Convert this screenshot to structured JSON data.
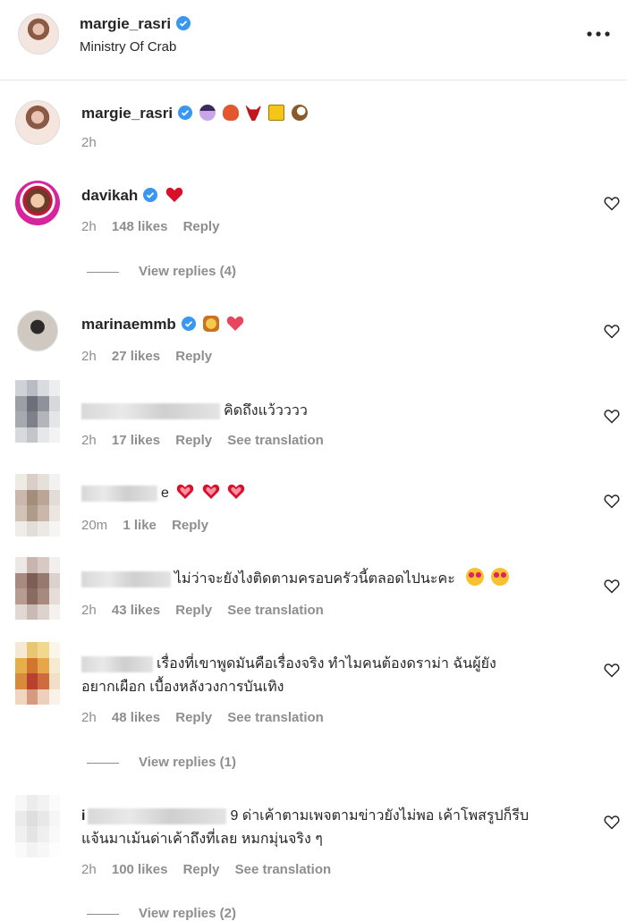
{
  "post_header": {
    "username": "margie_rasri",
    "subtitle": "Ministry Of Crab",
    "more_icon": "more-horizontal-icon"
  },
  "caption": {
    "username": "margie_rasri",
    "emojis": [
      "woman-tipping-hand",
      "crab",
      "bull",
      "yellow-square",
      "coconut"
    ],
    "time": "2h"
  },
  "comments": [
    {
      "username": "davikah",
      "verified": true,
      "text": "",
      "emoji": "red-heart",
      "time": "2h",
      "likes": "148 likes",
      "reply": "Reply",
      "see_translation": "",
      "view_replies": "View replies (4)"
    },
    {
      "username": "marinaemmb",
      "verified": true,
      "text": "",
      "emoji": "lion-face, red-heart",
      "time": "2h",
      "likes": "27 likes",
      "reply": "Reply",
      "see_translation": "",
      "view_replies": ""
    },
    {
      "username": "",
      "verified": false,
      "text": "คิดถึงแว้วววว",
      "time": "2h",
      "likes": "17 likes",
      "reply": "Reply",
      "see_translation": "See translation"
    },
    {
      "username": "",
      "verified": false,
      "text": "e",
      "emoji": "heart-decoration x3",
      "time": "20m",
      "likes": "1 like",
      "reply": "Reply",
      "see_translation": ""
    },
    {
      "username": "",
      "verified": false,
      "text": "ไม่ว่าจะยังไงติดตามครอบครัวนี้ตลอดไปนะคะ",
      "emoji": "heart-eyes x2",
      "time": "2h",
      "likes": "43 likes",
      "reply": "Reply",
      "see_translation": "See translation"
    },
    {
      "username": "",
      "verified": false,
      "text_line1": "เรื่องที่เขาพูดมันคือเรื่องจริง ทำไมคนต้องดราม่า ฉันผู้ยัง",
      "text_line2": "อยากเผือก เบื้องหลังวงการบันเทิง",
      "time": "2h",
      "likes": "48 likes",
      "reply": "Reply",
      "see_translation": "See translation",
      "view_replies": "View replies (1)"
    },
    {
      "username": "i",
      "verified": false,
      "text_line1": "9 ด่าเค้าตามเพจตามข่าวยังไม่พอ เค้าโพสรูปก็รีบ",
      "text_line2": "แจ้นมาเม้นด่าเค้าถึงที่เลย หมกมุ่นจริง ๆ",
      "time": "2h",
      "likes": "100 likes",
      "reply": "Reply",
      "see_translation": "See translation",
      "view_replies": "View replies (2)"
    }
  ],
  "colors": {
    "text": "#262626",
    "secondary": "#8e8e8e",
    "verified": "#3897f0",
    "heart": "#ed4956"
  }
}
